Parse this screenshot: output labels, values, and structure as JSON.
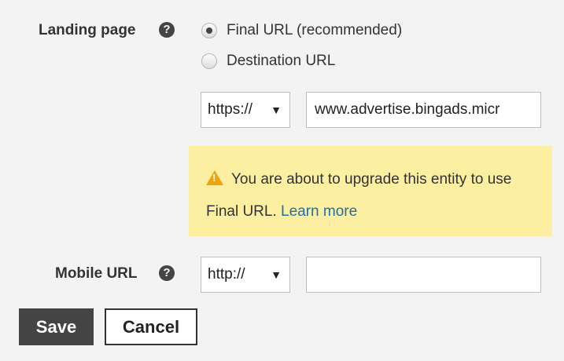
{
  "landing_page": {
    "label": "Landing page",
    "help_icon": "question-circle-icon",
    "options": [
      {
        "label": "Final URL (recommended)",
        "checked": true
      },
      {
        "label": "Destination URL",
        "checked": false
      }
    ],
    "protocol": "https://",
    "url_value": "www.advertise.bingads.micr"
  },
  "warning": {
    "icon": "warning-triangle-icon",
    "message": "You are about to upgrade this entity to use Final URL.",
    "link_text": "Learn more"
  },
  "mobile_url": {
    "label": "Mobile URL",
    "help_icon": "question-circle-icon",
    "protocol": "http://",
    "url_value": ""
  },
  "actions": {
    "save_label": "Save",
    "cancel_label": "Cancel"
  },
  "colors": {
    "background": "#f3f3f3",
    "warning_bg": "#fcefa1",
    "warning_icon": "#f0a30a",
    "link": "#1f6fa8",
    "save_button": "#444444"
  }
}
